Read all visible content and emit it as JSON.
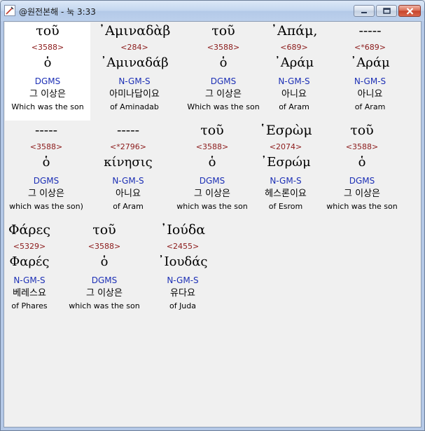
{
  "window": {
    "title": "@원전본해 - 눅 3:33",
    "controls": [
      "minimize",
      "maximize",
      "close"
    ]
  },
  "rows": [
    [
      {
        "greek": "τοῦ",
        "strong": "<3588>",
        "lemma": "ὁ",
        "morph": "DGMS",
        "korean": "그 이상은",
        "english": "Which was the son"
      },
      {
        "greek": "᾿Αμιναδὰβ",
        "strong": "<284>",
        "lemma": "᾿Αμιναδάβ",
        "morph": "N-GM-S",
        "korean": "아미나답이요",
        "english": "of Aminadab"
      },
      {
        "greek": "τοῦ",
        "strong": "<3588>",
        "lemma": "ὁ",
        "morph": "DGMS",
        "korean": "그 이상은",
        "english": "Which was the son"
      },
      {
        "greek": "᾿Απάμ,",
        "strong": "<689>",
        "lemma": "᾿Αράμ",
        "morph": "N-GM-S",
        "korean": "아니요",
        "english": "of Aram"
      },
      {
        "greek": "-----",
        "strong": "<*689>",
        "lemma": "᾿Αράμ",
        "morph": "N-GM-S",
        "korean": "아니요",
        "english": "of Aram"
      }
    ],
    [
      {
        "greek": "-----",
        "strong": "<3588>",
        "lemma": "ὁ",
        "morph": "DGMS",
        "korean": "그 이상은",
        "english": "which was the son)"
      },
      {
        "greek": "-----",
        "strong": "<*2796>",
        "lemma": "κίνησις",
        "morph": "N-GM-S",
        "korean": "아니요",
        "english": "of Aram"
      },
      {
        "greek": "τοῦ",
        "strong": "<3588>",
        "lemma": "ὁ",
        "morph": "DGMS",
        "korean": "그 이상은",
        "english": "which was the son"
      },
      {
        "greek": "῾Εσρὼμ",
        "strong": "<2074>",
        "lemma": "᾿Εσρώμ",
        "morph": "N-GM-S",
        "korean": "헤스론이요",
        "english": "of Esrom"
      },
      {
        "greek": "τοῦ",
        "strong": "<3588>",
        "lemma": "ὁ",
        "morph": "DGMS",
        "korean": "그 이상은",
        "english": "which was the son"
      }
    ],
    [
      {
        "greek": "Φάρες",
        "strong": "<5329>",
        "lemma": "Φαρές",
        "morph": "N-GM-S",
        "korean": "베레스요",
        "english": "of Phares"
      },
      {
        "greek": "τοῦ",
        "strong": "<3588>",
        "lemma": "ὁ",
        "morph": "DGMS",
        "korean": "그 이상은",
        "english": "which was the son"
      },
      {
        "greek": "᾿Ιούδα",
        "strong": "<2455>",
        "lemma": "᾿Ιουδάς",
        "morph": "N-GM-S",
        "korean": "유다요",
        "english": "of Juda"
      }
    ]
  ],
  "colors": {
    "strong": "#8b1a1a",
    "morph": "#1c2fb5",
    "selected_bg": "#ffffff",
    "client_bg": "#f0f0f0"
  }
}
